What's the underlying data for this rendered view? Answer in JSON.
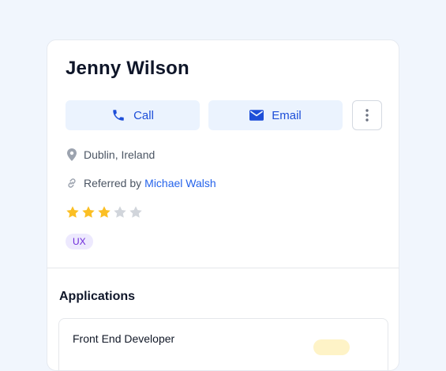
{
  "profile": {
    "name": "Jenny Wilson",
    "location": "Dublin, Ireland",
    "referred_prefix": "Referred by",
    "referrer": "Michael Walsh",
    "rating": 3,
    "rating_max": 5,
    "tag": "UX"
  },
  "actions": {
    "call_label": "Call",
    "email_label": "Email"
  },
  "applications": {
    "title": "Applications",
    "items": [
      {
        "title": "Front End Developer"
      }
    ]
  },
  "colors": {
    "accent": "#1d4ed8",
    "star_filled": "#fbbf24",
    "star_empty": "#d1d5db",
    "tag_bg": "#ede9fe",
    "tag_text": "#6d28d9"
  },
  "icons": {
    "call": "phone-icon",
    "email": "mail-icon",
    "more": "more-vertical-icon",
    "location": "map-pin-icon",
    "referral": "link-icon",
    "rating": "star-icon"
  }
}
